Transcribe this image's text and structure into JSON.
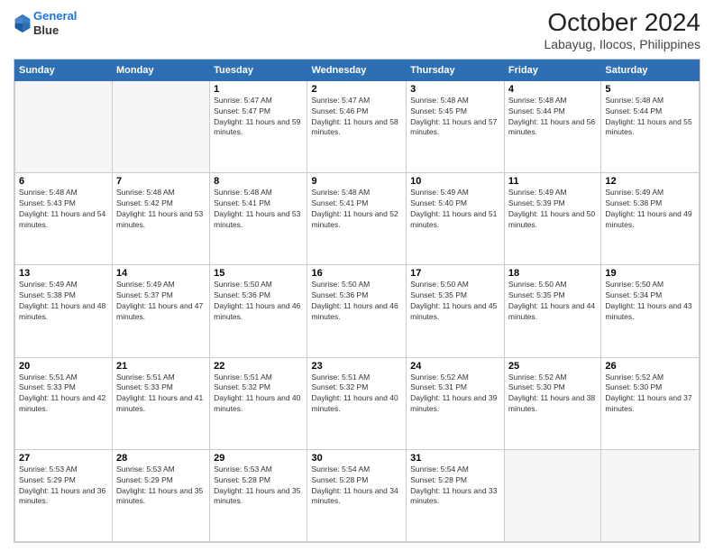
{
  "logo": {
    "line1": "General",
    "line2": "Blue"
  },
  "title": "October 2024",
  "subtitle": "Labayug, Ilocos, Philippines",
  "header_days": [
    "Sunday",
    "Monday",
    "Tuesday",
    "Wednesday",
    "Thursday",
    "Friday",
    "Saturday"
  ],
  "weeks": [
    [
      {
        "day": "",
        "info": ""
      },
      {
        "day": "",
        "info": ""
      },
      {
        "day": "1",
        "info": "Sunrise: 5:47 AM\nSunset: 5:47 PM\nDaylight: 11 hours and 59 minutes."
      },
      {
        "day": "2",
        "info": "Sunrise: 5:47 AM\nSunset: 5:46 PM\nDaylight: 11 hours and 58 minutes."
      },
      {
        "day": "3",
        "info": "Sunrise: 5:48 AM\nSunset: 5:45 PM\nDaylight: 11 hours and 57 minutes."
      },
      {
        "day": "4",
        "info": "Sunrise: 5:48 AM\nSunset: 5:44 PM\nDaylight: 11 hours and 56 minutes."
      },
      {
        "day": "5",
        "info": "Sunrise: 5:48 AM\nSunset: 5:44 PM\nDaylight: 11 hours and 55 minutes."
      }
    ],
    [
      {
        "day": "6",
        "info": "Sunrise: 5:48 AM\nSunset: 5:43 PM\nDaylight: 11 hours and 54 minutes."
      },
      {
        "day": "7",
        "info": "Sunrise: 5:48 AM\nSunset: 5:42 PM\nDaylight: 11 hours and 53 minutes."
      },
      {
        "day": "8",
        "info": "Sunrise: 5:48 AM\nSunset: 5:41 PM\nDaylight: 11 hours and 53 minutes."
      },
      {
        "day": "9",
        "info": "Sunrise: 5:48 AM\nSunset: 5:41 PM\nDaylight: 11 hours and 52 minutes."
      },
      {
        "day": "10",
        "info": "Sunrise: 5:49 AM\nSunset: 5:40 PM\nDaylight: 11 hours and 51 minutes."
      },
      {
        "day": "11",
        "info": "Sunrise: 5:49 AM\nSunset: 5:39 PM\nDaylight: 11 hours and 50 minutes."
      },
      {
        "day": "12",
        "info": "Sunrise: 5:49 AM\nSunset: 5:38 PM\nDaylight: 11 hours and 49 minutes."
      }
    ],
    [
      {
        "day": "13",
        "info": "Sunrise: 5:49 AM\nSunset: 5:38 PM\nDaylight: 11 hours and 48 minutes."
      },
      {
        "day": "14",
        "info": "Sunrise: 5:49 AM\nSunset: 5:37 PM\nDaylight: 11 hours and 47 minutes."
      },
      {
        "day": "15",
        "info": "Sunrise: 5:50 AM\nSunset: 5:36 PM\nDaylight: 11 hours and 46 minutes."
      },
      {
        "day": "16",
        "info": "Sunrise: 5:50 AM\nSunset: 5:36 PM\nDaylight: 11 hours and 46 minutes."
      },
      {
        "day": "17",
        "info": "Sunrise: 5:50 AM\nSunset: 5:35 PM\nDaylight: 11 hours and 45 minutes."
      },
      {
        "day": "18",
        "info": "Sunrise: 5:50 AM\nSunset: 5:35 PM\nDaylight: 11 hours and 44 minutes."
      },
      {
        "day": "19",
        "info": "Sunrise: 5:50 AM\nSunset: 5:34 PM\nDaylight: 11 hours and 43 minutes."
      }
    ],
    [
      {
        "day": "20",
        "info": "Sunrise: 5:51 AM\nSunset: 5:33 PM\nDaylight: 11 hours and 42 minutes."
      },
      {
        "day": "21",
        "info": "Sunrise: 5:51 AM\nSunset: 5:33 PM\nDaylight: 11 hours and 41 minutes."
      },
      {
        "day": "22",
        "info": "Sunrise: 5:51 AM\nSunset: 5:32 PM\nDaylight: 11 hours and 40 minutes."
      },
      {
        "day": "23",
        "info": "Sunrise: 5:51 AM\nSunset: 5:32 PM\nDaylight: 11 hours and 40 minutes."
      },
      {
        "day": "24",
        "info": "Sunrise: 5:52 AM\nSunset: 5:31 PM\nDaylight: 11 hours and 39 minutes."
      },
      {
        "day": "25",
        "info": "Sunrise: 5:52 AM\nSunset: 5:30 PM\nDaylight: 11 hours and 38 minutes."
      },
      {
        "day": "26",
        "info": "Sunrise: 5:52 AM\nSunset: 5:30 PM\nDaylight: 11 hours and 37 minutes."
      }
    ],
    [
      {
        "day": "27",
        "info": "Sunrise: 5:53 AM\nSunset: 5:29 PM\nDaylight: 11 hours and 36 minutes."
      },
      {
        "day": "28",
        "info": "Sunrise: 5:53 AM\nSunset: 5:29 PM\nDaylight: 11 hours and 35 minutes."
      },
      {
        "day": "29",
        "info": "Sunrise: 5:53 AM\nSunset: 5:28 PM\nDaylight: 11 hours and 35 minutes."
      },
      {
        "day": "30",
        "info": "Sunrise: 5:54 AM\nSunset: 5:28 PM\nDaylight: 11 hours and 34 minutes."
      },
      {
        "day": "31",
        "info": "Sunrise: 5:54 AM\nSunset: 5:28 PM\nDaylight: 11 hours and 33 minutes."
      },
      {
        "day": "",
        "info": ""
      },
      {
        "day": "",
        "info": ""
      }
    ]
  ]
}
